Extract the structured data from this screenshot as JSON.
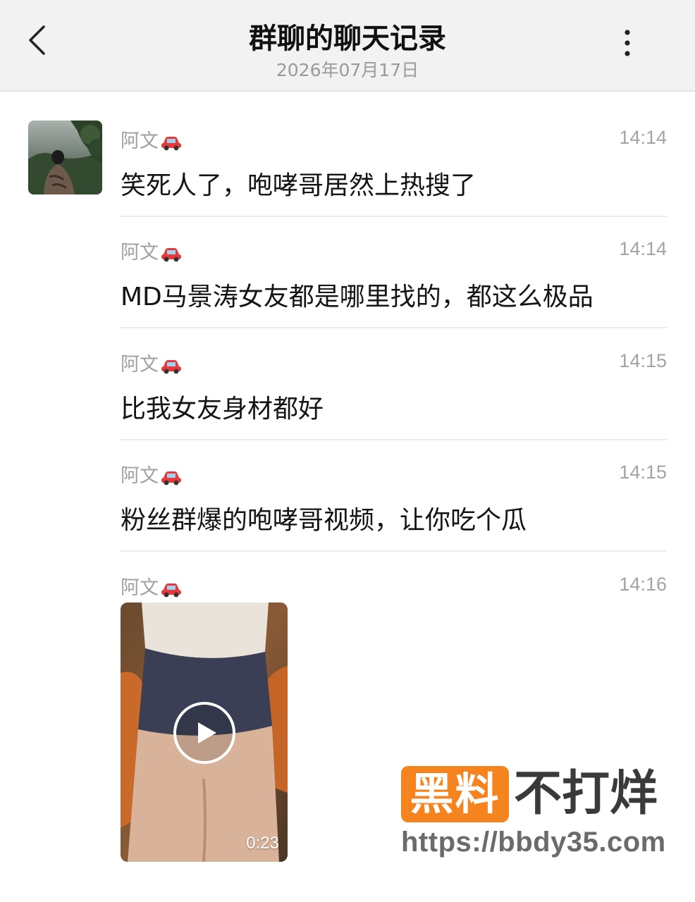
{
  "header": {
    "title": "群聊的聊天记录",
    "date": "2026年07月17日",
    "back_icon": "chevron-left-icon",
    "more_icon": "more-vertical-icon"
  },
  "colors": {
    "header_bg": "#f2f2f2",
    "meta_text": "#a0a0a0",
    "watermark_orange": "#f5841f"
  },
  "messages": [
    {
      "sender": "阿文",
      "sender_icon": "car-emoji-icon",
      "time": "14:14",
      "text": "笑死人了，咆哮哥居然上热搜了"
    },
    {
      "sender": "阿文",
      "sender_icon": "car-emoji-icon",
      "time": "14:14",
      "text": "MD马景涛女友都是哪里找的，都这么极品"
    },
    {
      "sender": "阿文",
      "sender_icon": "car-emoji-icon",
      "time": "14:15",
      "text": "比我女友身材都好"
    },
    {
      "sender": "阿文",
      "sender_icon": "car-emoji-icon",
      "time": "14:15",
      "text": "粉丝群爆的咆哮哥视频，让你吃个瓜"
    },
    {
      "sender": "阿文",
      "sender_icon": "car-emoji-icon",
      "time": "14:16",
      "video_duration": "0:23"
    }
  ],
  "watermark": {
    "badge": "黑料",
    "text": "不打烊",
    "url": "https://bbdy35.com"
  }
}
